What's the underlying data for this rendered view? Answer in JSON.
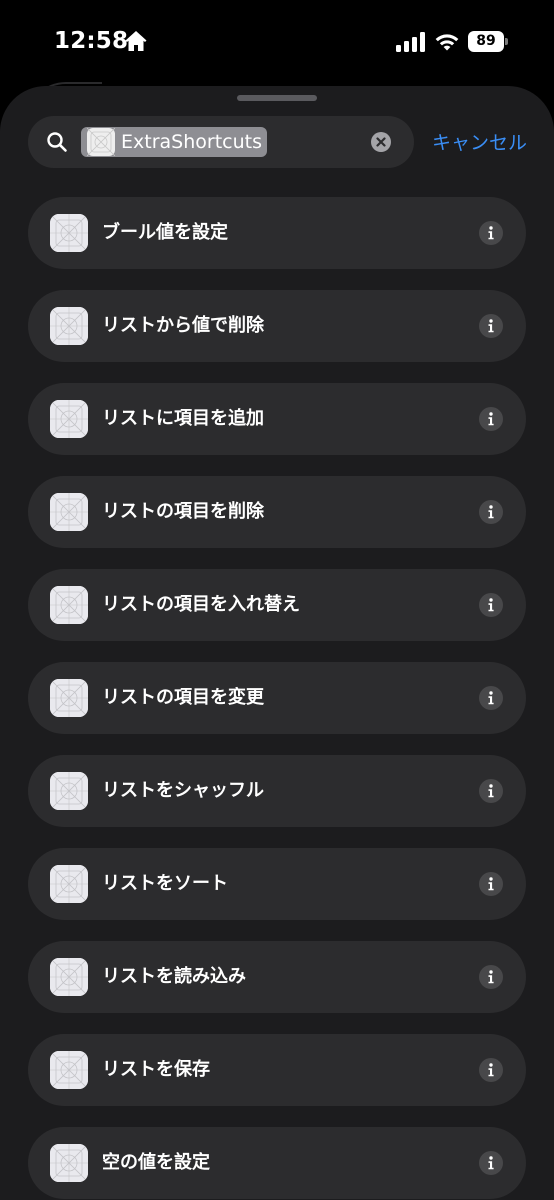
{
  "status_bar": {
    "time": "12:58",
    "battery_percent": "89",
    "icons": [
      "home-icon",
      "signal-icon",
      "wifi-icon",
      "battery-icon"
    ]
  },
  "search": {
    "token_label": "ExtraShortcuts",
    "cancel_label": "キャンセル",
    "icons": [
      "search-icon",
      "clear-icon"
    ]
  },
  "results": [
    {
      "label": "ブール値を設定"
    },
    {
      "label": "リストから値で削除"
    },
    {
      "label": "リストに項目を追加"
    },
    {
      "label": "リストの項目を削除"
    },
    {
      "label": "リストの項目を入れ替え"
    },
    {
      "label": "リストの項目を変更"
    },
    {
      "label": "リストをシャッフル"
    },
    {
      "label": "リストをソート"
    },
    {
      "label": "リストを読み込み"
    },
    {
      "label": "リストを保存"
    },
    {
      "label": "空の値を設定"
    }
  ],
  "colors": {
    "background": "#000000",
    "sheet": "#1c1c1e",
    "row": "#2c2c2e",
    "accent": "#3a8ef6",
    "token": "#8e8e93"
  }
}
